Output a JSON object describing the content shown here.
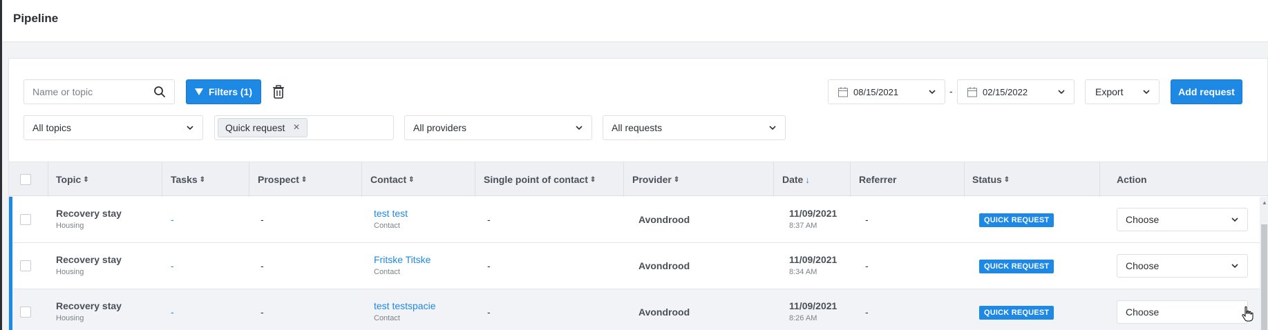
{
  "page": {
    "title": "Pipeline"
  },
  "toolbar": {
    "search_placeholder": "Name or topic",
    "filters_label": "Filters (1)",
    "date_from": "08/15/2021",
    "date_separator": "-",
    "date_to": "02/15/2022",
    "export_label": "Export",
    "add_request_label": "Add request"
  },
  "filters": {
    "topics": "All topics",
    "tag": "Quick request",
    "tag_remove": "×",
    "providers": "All providers",
    "requests": "All requests"
  },
  "table": {
    "columns": [
      {
        "label": "Topic",
        "sort": "⇕"
      },
      {
        "label": "Tasks",
        "sort": "⇕"
      },
      {
        "label": "Prospect",
        "sort": "⇕"
      },
      {
        "label": "Contact",
        "sort": "⇕"
      },
      {
        "label": "Single point of contact",
        "sort": "⇕"
      },
      {
        "label": "Provider",
        "sort": "⇕"
      },
      {
        "label": "Date",
        "sort": "↓"
      },
      {
        "label": "Referrer",
        "sort": ""
      },
      {
        "label": "Status",
        "sort": "⇕"
      },
      {
        "label": "Action",
        "sort": ""
      }
    ],
    "rows": [
      {
        "topic": "Recovery stay",
        "topic_sub": "Housing",
        "tasks": "-",
        "prospect": "-",
        "contact": "test test",
        "contact_sub": "Contact",
        "spoc": "-",
        "provider": "Avondrood",
        "date": "11/09/2021",
        "time": "8:37 AM",
        "referrer": "-",
        "status": "QUICK REQUEST",
        "action": "Choose"
      },
      {
        "topic": "Recovery stay",
        "topic_sub": "Housing",
        "tasks": "-",
        "prospect": "-",
        "contact": "Fritske Titske",
        "contact_sub": "Contact",
        "spoc": "-",
        "provider": "Avondrood",
        "date": "11/09/2021",
        "time": "8:34 AM",
        "referrer": "-",
        "status": "QUICK REQUEST",
        "action": "Choose"
      },
      {
        "topic": "Recovery stay",
        "topic_sub": "Housing",
        "tasks": "-",
        "prospect": "-",
        "contact": "test testspacie",
        "contact_sub": "Contact",
        "spoc": "-",
        "provider": "Avondrood",
        "date": "11/09/2021",
        "time": "8:26 AM",
        "referrer": "-",
        "status": "QUICK REQUEST",
        "action": "Choose"
      }
    ]
  },
  "colors": {
    "accent": "#1e88e5"
  }
}
